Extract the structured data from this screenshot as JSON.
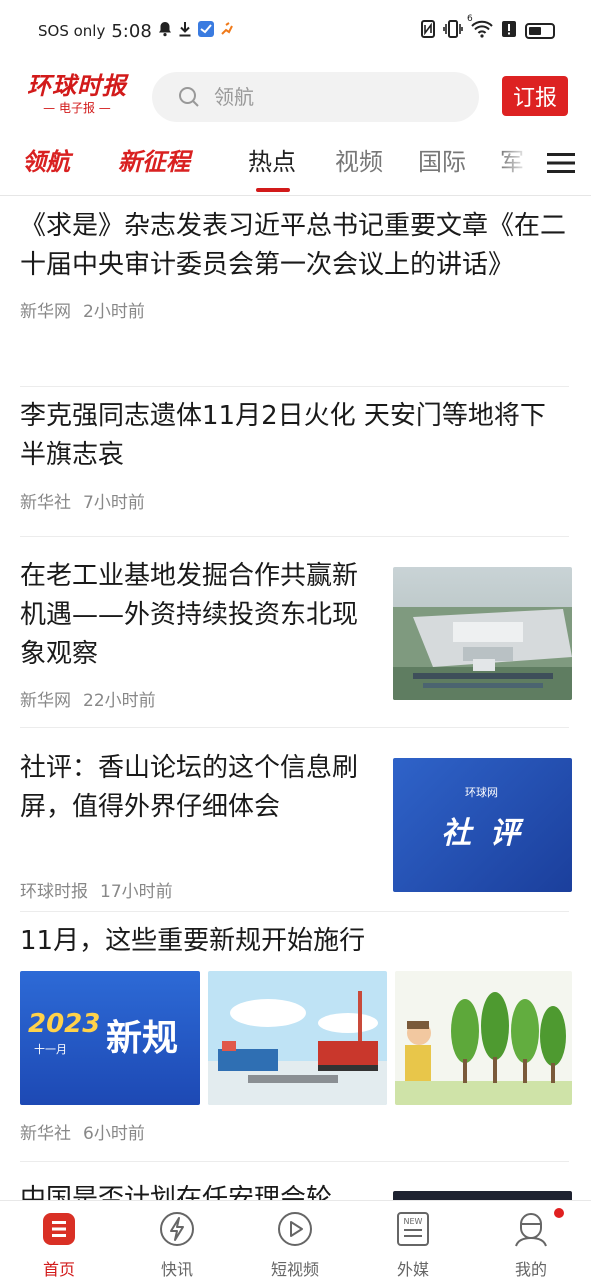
{
  "status_bar": {
    "carrier": "SOS only",
    "time": "5:08",
    "network_superscript": "6"
  },
  "header": {
    "logo_title": "环球时报",
    "logo_subtitle": "— 电子报 —",
    "search_placeholder": "领航",
    "subscribe_label": "订报"
  },
  "tabs": [
    {
      "label": "领航",
      "style": "brand"
    },
    {
      "label": "新征程",
      "style": "brand"
    },
    {
      "label": "热点",
      "style": "active"
    },
    {
      "label": "视频",
      "style": "normal"
    },
    {
      "label": "国际",
      "style": "normal"
    },
    {
      "label": "军",
      "style": "normal"
    }
  ],
  "articles": [
    {
      "title": "《求是》杂志发表习近平总书记重要文章《在二十届中央审计委员会第一次会议上的讲话》",
      "source": "新华网",
      "time": "2小时前"
    },
    {
      "title": "李克强同志遗体11月2日火化 天安门等地将下半旗志哀",
      "source": "新华社",
      "time": "7小时前"
    },
    {
      "title": "在老工业基地发掘合作共赢新机遇——外资持续投资东北现象观察",
      "source": "新华网",
      "time": "22小时前"
    },
    {
      "title": "社评：香山论坛的这个信息刷屏，值得外界仔细体会",
      "source": "环球时报",
      "time": "17小时前",
      "thumb_brand": "环球网",
      "thumb_text": "社 评"
    },
    {
      "title": "11月，这些重要新规开始施行",
      "source": "新华社",
      "time": "6小时前",
      "thumb1_year": "2023",
      "thumb1_month": "十一月",
      "thumb1_text": "新规"
    },
    {
      "title": "中国是否计划在任安理会轮"
    }
  ],
  "bottom_nav": [
    {
      "label": "首页",
      "icon": "home-icon",
      "active": true
    },
    {
      "label": "快讯",
      "icon": "lightning-icon",
      "active": false
    },
    {
      "label": "短视频",
      "icon": "play-icon",
      "active": false
    },
    {
      "label": "外媒",
      "icon": "news-icon",
      "active": false
    },
    {
      "label": "我的",
      "icon": "profile-icon",
      "active": false
    }
  ],
  "colors": {
    "brand_red": "#d21a1a",
    "text_primary": "#1a1a1a",
    "text_meta": "#888888",
    "search_bg": "#f2f2f2"
  }
}
